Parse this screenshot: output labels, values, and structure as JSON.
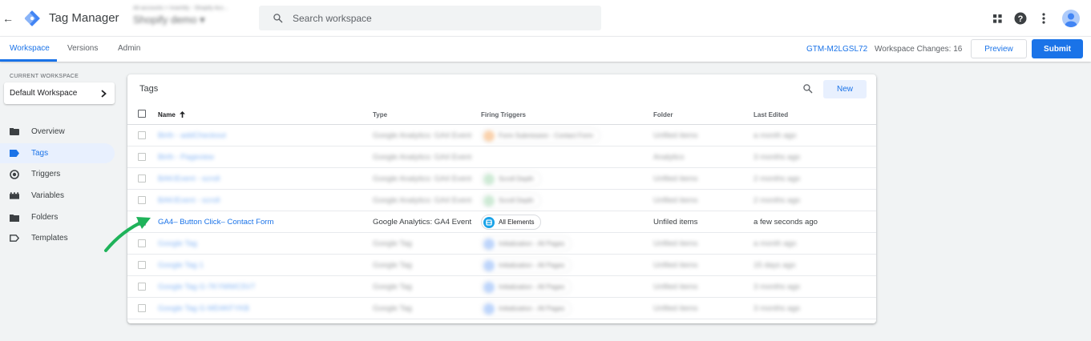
{
  "topbar": {
    "back_label": "←",
    "app_title": "Tag Manager",
    "account_line1": "All accounts > Insertify - Shopify Acc...",
    "account_line2": "Shopify demo ▾",
    "search_placeholder": "Search workspace"
  },
  "nav": {
    "tabs": [
      {
        "label": "Workspace",
        "active": true
      },
      {
        "label": "Versions",
        "active": false
      },
      {
        "label": "Admin",
        "active": false
      }
    ],
    "container_id": "GTM-M2LGSL72",
    "workspace_changes": "Workspace Changes: 16",
    "preview_label": "Preview",
    "submit_label": "Submit"
  },
  "sidebar": {
    "current_workspace_label": "CURRENT WORKSPACE",
    "workspace_name": "Default Workspace",
    "items": [
      {
        "label": "Overview",
        "icon": "overview-icon",
        "active": false
      },
      {
        "label": "Tags",
        "icon": "tag-icon",
        "active": true
      },
      {
        "label": "Triggers",
        "icon": "trigger-icon",
        "active": false
      },
      {
        "label": "Variables",
        "icon": "variable-icon",
        "active": false
      },
      {
        "label": "Folders",
        "icon": "folder-icon",
        "active": false
      },
      {
        "label": "Templates",
        "icon": "template-icon",
        "active": false
      }
    ]
  },
  "tags": {
    "title": "Tags",
    "new_label": "New",
    "columns": {
      "name": "Name",
      "type": "Type",
      "triggers": "Firing Triggers",
      "folder": "Folder",
      "edited": "Last Edited"
    },
    "rows": [
      {
        "name": "Birth - addCheckout",
        "type": "Google Analytics: GA4 Event",
        "trigger": "Form Submission - Contact Form",
        "trigger_color": "#f6ae6b",
        "folder": "Unfiled items",
        "edited": "a month ago",
        "blurred": true
      },
      {
        "name": "Birth - Pageview",
        "type": "Google Analytics: GA4 Event",
        "trigger": "",
        "trigger_color": "",
        "folder": "Analytics",
        "edited": "3 months ago",
        "blurred": true
      },
      {
        "name": "BAK/Event - scroll",
        "type": "Google Analytics: GA4 Event",
        "trigger": "Scroll Depth",
        "trigger_color": "#a8dab5",
        "folder": "Unfiled items",
        "edited": "2 months ago",
        "blurred": true
      },
      {
        "name": "BAK/Event - scroll",
        "type": "Google Analytics: GA4 Event",
        "trigger": "Scroll Depth",
        "trigger_color": "#a8dab5",
        "folder": "Unfiled items",
        "edited": "2 months ago",
        "blurred": true
      },
      {
        "name": "GA4– Button Click– Contact Form",
        "type": "Google Analytics: GA4 Event",
        "trigger": "All Elements",
        "trigger_color": "#1aa3e8",
        "folder": "Unfiled items",
        "edited": "a few seconds ago",
        "blurred": false
      },
      {
        "name": "Google Tag",
        "type": "Google Tag",
        "trigger": "Initialization - All Pages",
        "trigger_color": "#8ab4f8",
        "folder": "Unfiled items",
        "edited": "a month ago",
        "blurred": true
      },
      {
        "name": "Google Tag 1",
        "type": "Google Tag",
        "trigger": "Initialization - All Pages",
        "trigger_color": "#8ab4f8",
        "folder": "Unfiled items",
        "edited": "15 days ago",
        "blurred": true
      },
      {
        "name": "Google Tag G-7KYMWC5V7",
        "type": "Google Tag",
        "trigger": "Initialization - All Pages",
        "trigger_color": "#8ab4f8",
        "folder": "Unfiled items",
        "edited": "3 months ago",
        "blurred": true
      },
      {
        "name": "Google Tag G-MD4KFYKB",
        "type": "Google Tag",
        "trigger": "Initialization - All Pages",
        "trigger_color": "#8ab4f8",
        "folder": "Unfiled items",
        "edited": "3 months ago",
        "blurred": true
      }
    ]
  },
  "colors": {
    "accent": "#1a73e8",
    "annotation_arrow": "#1fb35a"
  }
}
